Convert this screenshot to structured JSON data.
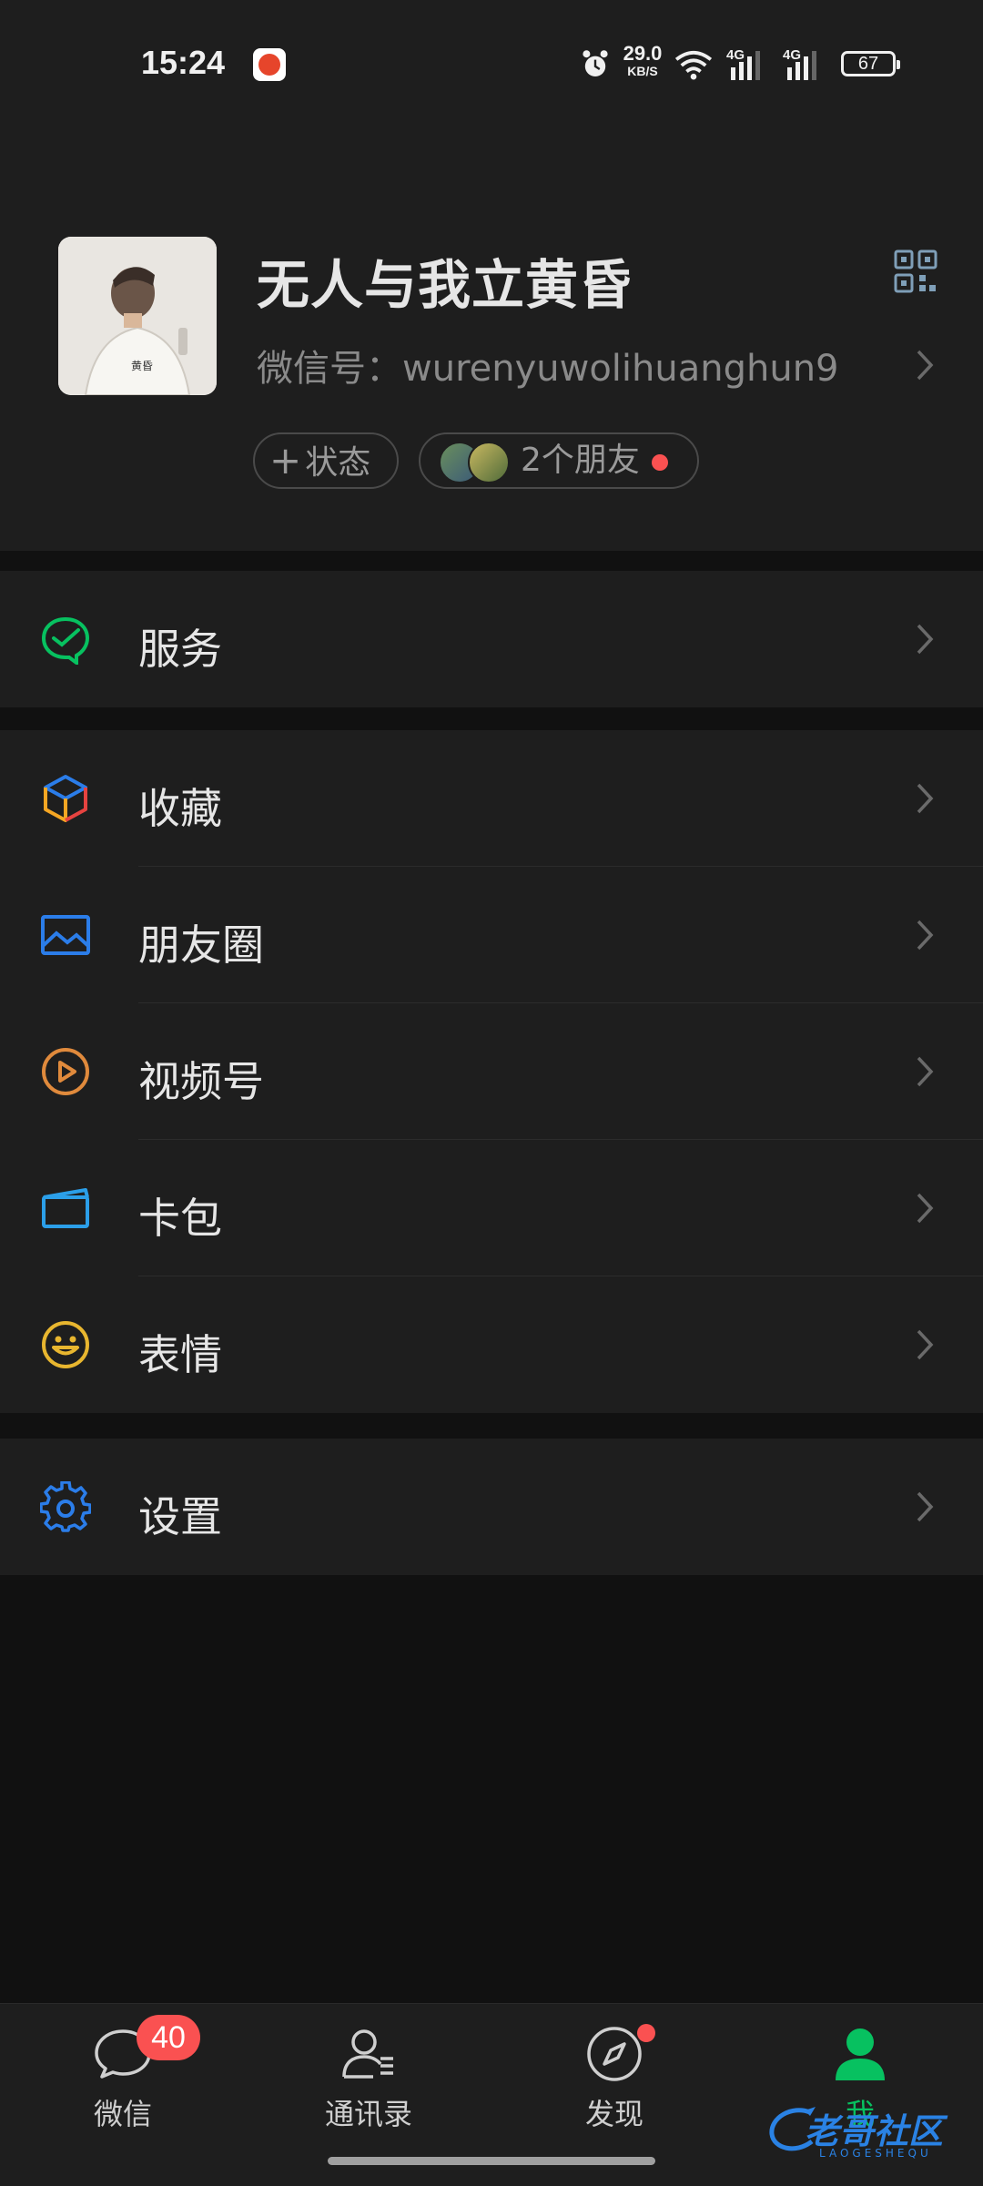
{
  "status_bar": {
    "time": "15:24",
    "net_speed_value": "29.0",
    "net_speed_unit": "KB/S",
    "signal_1": "4G",
    "signal_2": "4G",
    "battery": "67"
  },
  "profile": {
    "nickname": "无人与我立黄昏",
    "wechat_id": "微信号：wurenyuwolihuanghun9",
    "status_button": "状态",
    "status_plus": "+",
    "friends_text": "2个朋友",
    "avatar_shirt_text": "黄昏"
  },
  "menu": {
    "service": "服务",
    "favorites": "收藏",
    "moments": "朋友圈",
    "channels": "视频号",
    "cards": "卡包",
    "stickers": "表情",
    "settings": "设置"
  },
  "tabs": [
    {
      "label": "微信",
      "badge": "40"
    },
    {
      "label": "通讯录"
    },
    {
      "label": "发现"
    },
    {
      "label": "我"
    }
  ],
  "watermark": {
    "text": "老哥社区",
    "sub": "LAOGESHEQU"
  },
  "colors": {
    "accent": "#07c160",
    "badge": "#fa5151",
    "background": "#111111",
    "surface": "#1e1e1e"
  }
}
